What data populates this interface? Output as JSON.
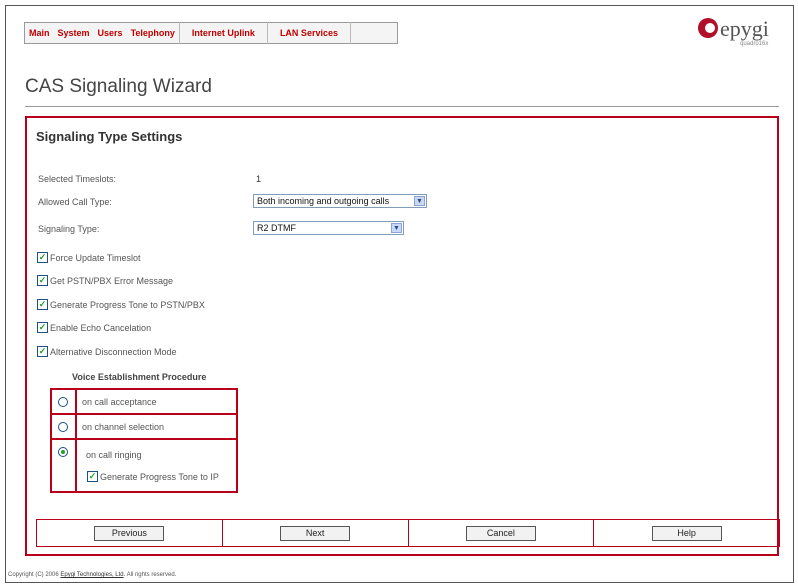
{
  "menu": [
    "Main",
    "System",
    "Users",
    "Telephony",
    "Internet Uplink",
    "LAN Services"
  ],
  "logo": {
    "brand": "epygi",
    "model": "quadro16x"
  },
  "page_title": "CAS Signaling Wizard",
  "panel_title": "Signaling Type Settings",
  "fields": {
    "timeslots_label": "Selected Timeslots:",
    "timeslots_value": "1",
    "call_type_label": "Allowed Call Type:",
    "call_type_value": "Both incoming and outgoing calls",
    "signaling_label": "Signaling Type:",
    "signaling_value": "R2 DTMF"
  },
  "checkboxes": [
    {
      "label": "Force Update Timeslot",
      "checked": true
    },
    {
      "label": "Get PSTN/PBX Error Message",
      "checked": true
    },
    {
      "label": "Generate Progress Tone to PSTN/PBX",
      "checked": true
    },
    {
      "label": "Enable Echo Cancelation",
      "checked": true
    },
    {
      "label": "Alternative Disconnection Mode",
      "checked": true
    }
  ],
  "voice": {
    "heading": "Voice Establishment Procedure",
    "options": [
      "on call acceptance",
      "on channel selection",
      "on call ringing"
    ],
    "selected": "on call ringing",
    "sub_checkbox": "Generate Progress Tone to IP"
  },
  "buttons": [
    "Previous",
    "Next",
    "Cancel",
    "Help"
  ],
  "footer": {
    "prefix": "Copyright (C) 2006 ",
    "link": "Epygi Technologies, Ltd",
    "suffix": ". All rights reserved."
  }
}
